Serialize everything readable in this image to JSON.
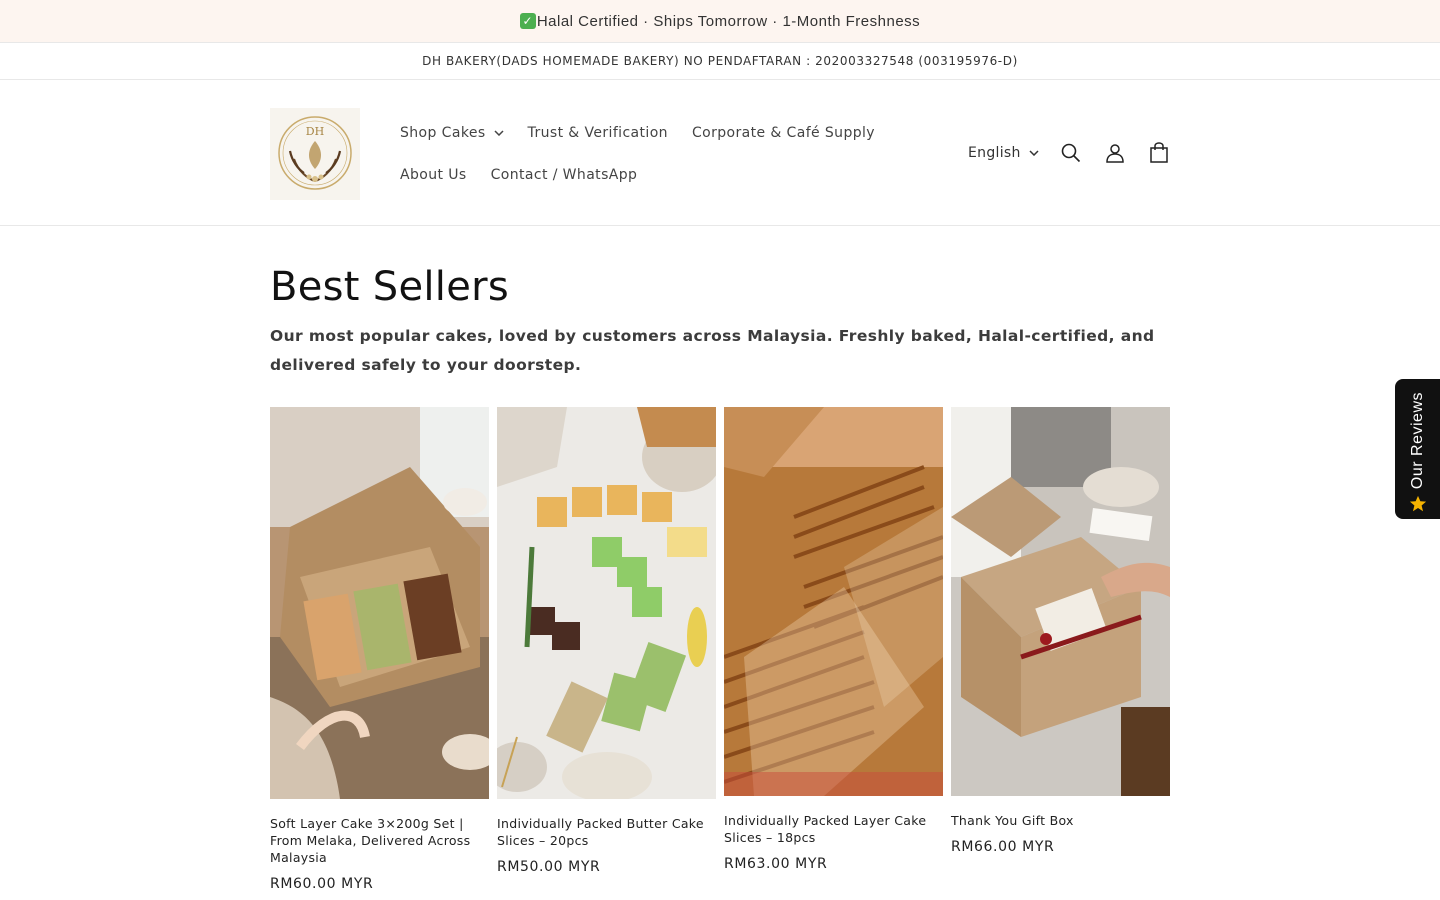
{
  "announcement": {
    "check": "✓",
    "text": "Halal Certified · Ships Tomorrow · 1-Month Freshness"
  },
  "registration": "DH BAKERY(DADS HOMEMADE BAKERY) NO PENDAFTARAN : 202003327548 (003195976-D)",
  "header": {
    "logo_text": "DH",
    "nav": [
      {
        "label": "Shop Cakes",
        "has_dropdown": true
      },
      {
        "label": "Trust & Verification"
      },
      {
        "label": "Corporate & Café Supply"
      },
      {
        "label": "About Us"
      },
      {
        "label": "Contact / WhatsApp"
      }
    ],
    "language": "English",
    "icons": [
      "search-icon",
      "account-icon",
      "cart-icon"
    ]
  },
  "main": {
    "title": "Best Sellers",
    "description": "Our most popular cakes, loved by customers across Malaysia. Freshly baked, Halal-certified, and delivered safely to your doorstep."
  },
  "products": [
    {
      "name": "Soft Layer Cake 3×200g Set | From Melaka, Delivered Across Malaysia",
      "price": "RM60.00 MYR"
    },
    {
      "name": "Individually Packed Butter Cake Slices – 20pcs",
      "price": "RM50.00 MYR"
    },
    {
      "name": "Individually Packed Layer Cake Slices – 18pcs",
      "price": "RM63.00 MYR"
    },
    {
      "name": "Thank You Gift Box",
      "price": "RM66.00 MYR"
    }
  ],
  "reviews_tab": {
    "label": "Our Reviews",
    "star": "★"
  },
  "colors": {
    "announcement_bg": "#fdf5f0",
    "logo_gold": "#b8975a",
    "review_tab_bg": "#111111",
    "star": "#f5b301"
  }
}
